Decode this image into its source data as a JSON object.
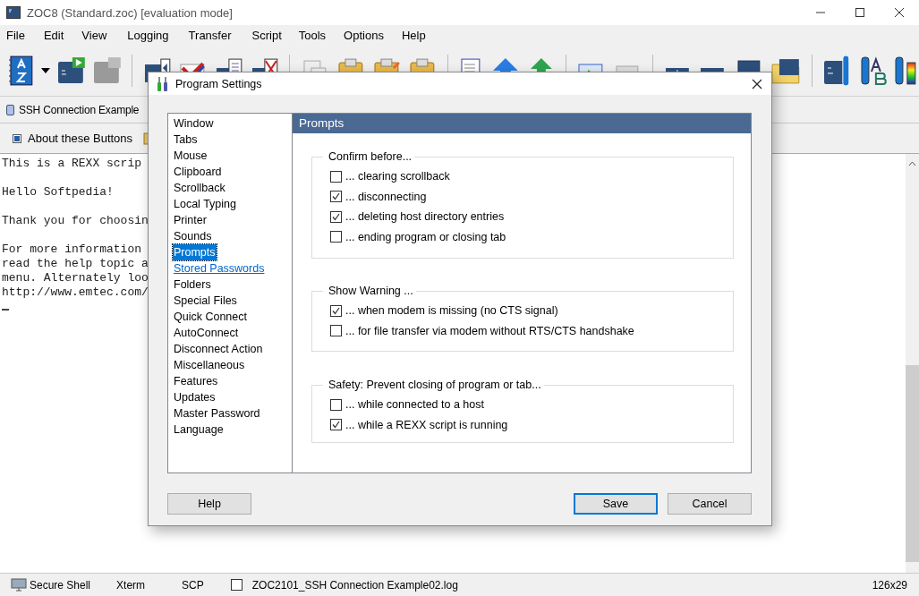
{
  "window": {
    "title": "ZOC8 (Standard.zoc) [evaluation mode]"
  },
  "menu": [
    "File",
    "Edit",
    "View",
    "Logging",
    "Transfer",
    "Script",
    "Tools",
    "Options",
    "Help"
  ],
  "tabs": [
    {
      "label": "SSH Connection Example",
      "selected": true
    }
  ],
  "button_bar": [
    {
      "label": "About these Buttons"
    }
  ],
  "terminal": {
    "paragraphs": [
      [
        "This is a REXX scrip"
      ],
      [
        "Hello Softpedia!"
      ],
      [
        "Thank you for choosin"
      ],
      [
        "For more information",
        "read the help topic a",
        "menu. Alternately loo",
        "http://www.emtec.com/"
      ]
    ]
  },
  "dialog": {
    "title": "Program Settings",
    "categories": [
      {
        "label": "Window",
        "selected": false,
        "kind": "item"
      },
      {
        "label": "Tabs",
        "selected": false,
        "kind": "item"
      },
      {
        "label": "Mouse",
        "selected": false,
        "kind": "item"
      },
      {
        "label": "Clipboard",
        "selected": false,
        "kind": "item"
      },
      {
        "label": "Scrollback",
        "selected": false,
        "kind": "item"
      },
      {
        "label": "Local Typing",
        "selected": false,
        "kind": "item"
      },
      {
        "label": "Printer",
        "selected": false,
        "kind": "item"
      },
      {
        "label": "Sounds",
        "selected": false,
        "kind": "item"
      },
      {
        "label": "Prompts",
        "selected": true,
        "kind": "item"
      },
      {
        "label": "Stored Passwords",
        "selected": false,
        "kind": "link"
      },
      {
        "label": "Folders",
        "selected": false,
        "kind": "item"
      },
      {
        "label": "Special Files",
        "selected": false,
        "kind": "item"
      },
      {
        "label": "Quick Connect",
        "selected": false,
        "kind": "item"
      },
      {
        "label": "AutoConnect",
        "selected": false,
        "kind": "item"
      },
      {
        "label": "Disconnect Action",
        "selected": false,
        "kind": "item"
      },
      {
        "label": "Miscellaneous",
        "selected": false,
        "kind": "item"
      },
      {
        "label": "Features",
        "selected": false,
        "kind": "item"
      },
      {
        "label": "Updates",
        "selected": false,
        "kind": "item"
      },
      {
        "label": "Master Password",
        "selected": false,
        "kind": "item"
      },
      {
        "label": "Language",
        "selected": false,
        "kind": "item"
      }
    ],
    "panel_title": "Prompts",
    "groups": [
      {
        "title": "Confirm before...",
        "options": [
          {
            "label": "... clearing scrollback",
            "checked": false
          },
          {
            "label": "... disconnecting",
            "checked": true
          },
          {
            "label": "... deleting host directory entries",
            "checked": true
          },
          {
            "label": "... ending program or closing tab",
            "checked": false
          }
        ]
      },
      {
        "title": "Show Warning ...",
        "options": [
          {
            "label": "... when modem is missing (no CTS signal)",
            "checked": true
          },
          {
            "label": "... for file transfer via modem without RTS/CTS handshake",
            "checked": false
          }
        ]
      },
      {
        "title": "Safety: Prevent closing of program or tab...",
        "options": [
          {
            "label": "... while connected to a host",
            "checked": false
          },
          {
            "label": "... while a REXX script is running",
            "checked": true
          }
        ]
      }
    ],
    "buttons": [
      {
        "label": "Help",
        "default": false
      },
      {
        "label": "Save",
        "default": true
      },
      {
        "label": "Cancel",
        "default": false
      }
    ]
  },
  "status_bar": {
    "connection": "Secure Shell",
    "emulation": "Xterm",
    "transfer": "SCP",
    "log_enabled": false,
    "log_file": "ZOC2101_SSH Connection Example02.log",
    "size": "126x29"
  }
}
